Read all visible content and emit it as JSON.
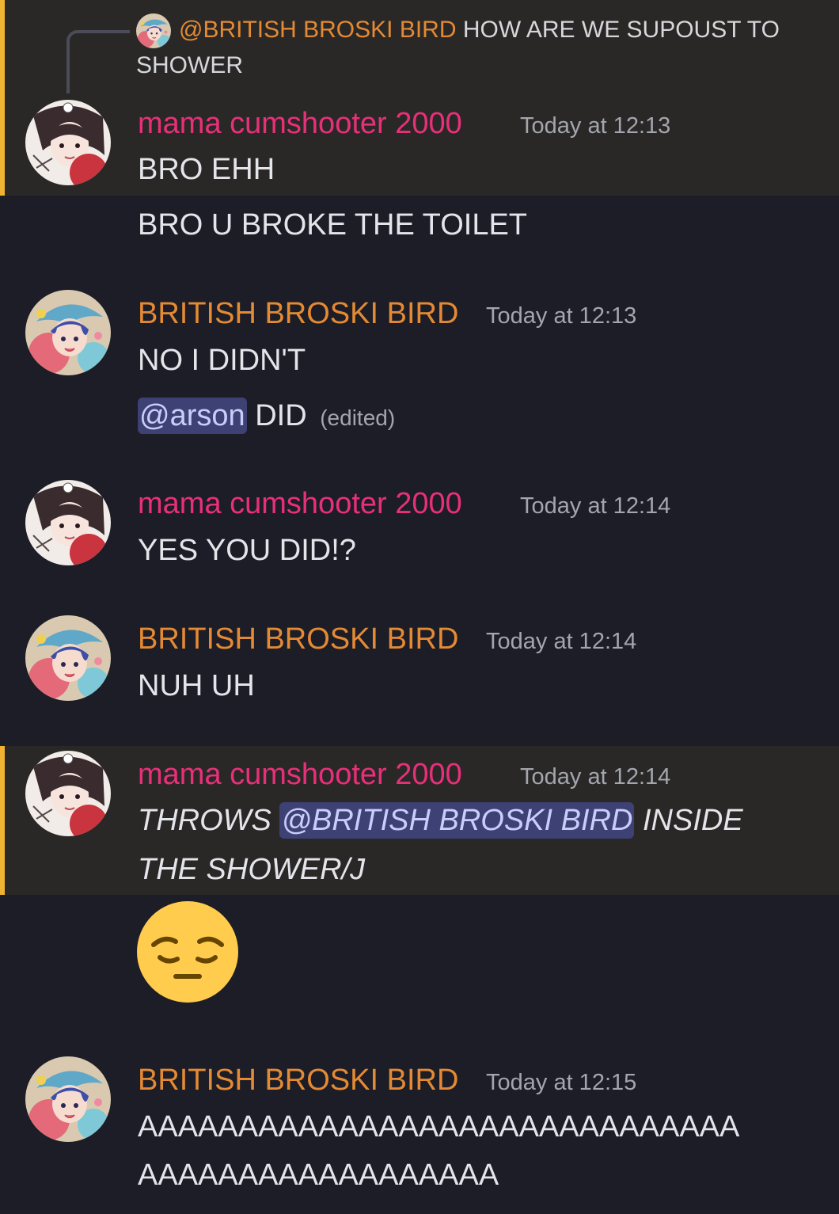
{
  "reply": {
    "mention": "@BRITISH BROSKI BIRD",
    "line1": "HOW ARE WE SUPOUST TO",
    "line2": "SHOWER"
  },
  "messages": [
    {
      "author": "mama cumshooter 2000",
      "time": "Today at 12:13",
      "lines": [
        "BRO EHH",
        "BRO U BROKE THE TOILET"
      ]
    },
    {
      "author": "BRITISH BROSKI BIRD",
      "time": "Today at 12:13",
      "line1": "NO I DIDN'T",
      "mention": "@arson",
      "line2_rest": "DID",
      "edited": "(edited)"
    },
    {
      "author": "mama cumshooter 2000",
      "time": "Today at 12:14",
      "line1": "YES YOU DID!?"
    },
    {
      "author": "BRITISH BROSKI BIRD",
      "time": "Today at 12:14",
      "line1": "NUH UH"
    },
    {
      "author": "mama cumshooter 2000",
      "time": "Today at 12:14",
      "pre": "THROWS",
      "mention": "@BRITISH BROSKI BIRD",
      "post": "INSIDE",
      "line2": "THE SHOWER/J",
      "emoji": "pensive-face"
    },
    {
      "author": "BRITISH BROSKI BIRD",
      "time": "Today at 12:15",
      "line1": "AAAAAAAAAAAAAAAAAAAAAAAAAAAAAA",
      "line2": "AAAAAAAAAAAAAAAAAA"
    }
  ],
  "colors": {
    "background": "#1c1d26",
    "highlight": "#2a2826",
    "highlight_bar": "#f0b232",
    "mama_name": "#e8307a",
    "bird_name": "#e48a34",
    "mention_bg": "#3d4173"
  }
}
